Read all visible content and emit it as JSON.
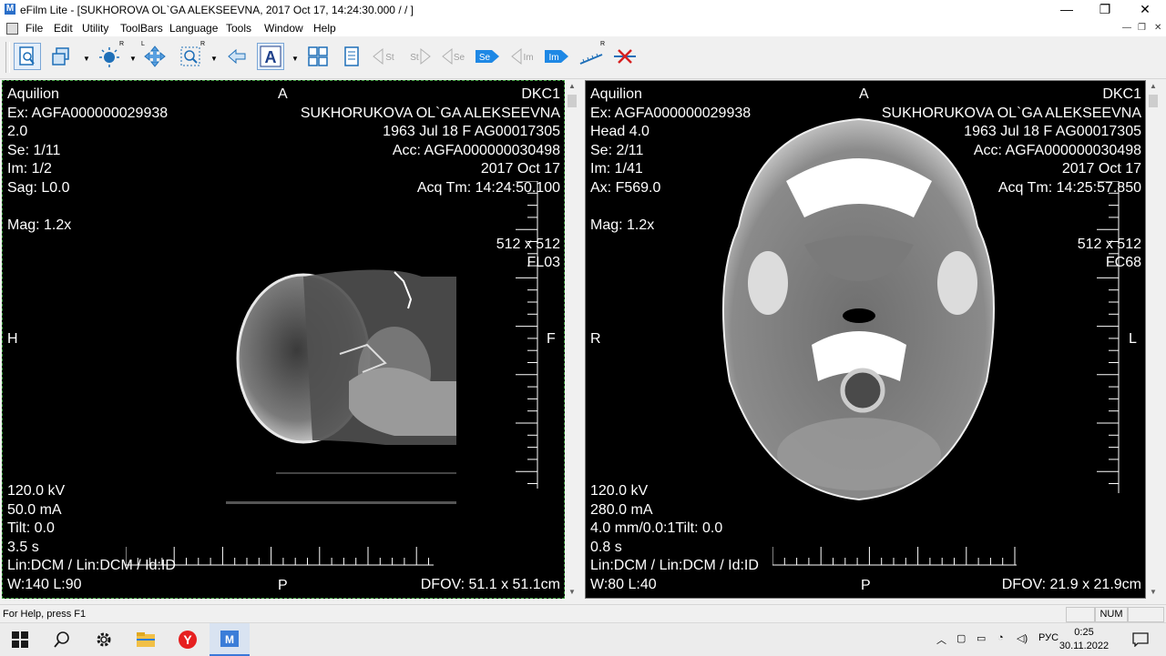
{
  "window": {
    "title": "eFilm Lite - [SUKHOROVA OL`GA ALEKSEEVNA, 2017 Oct 17, 14:24:30.000 /  /  ]",
    "app_icon": "M",
    "minimize": "—",
    "restore": "❐",
    "close": "✕"
  },
  "menu": [
    "File",
    "Edit",
    "Utility",
    "ToolBars",
    "Language",
    "Tools",
    "Window",
    "Help"
  ],
  "mdi": {
    "minimize": "—",
    "restore": "❐",
    "close": "✕"
  },
  "toolbar": {
    "buttons": [
      "page-icon",
      "series-layout-icon",
      "window-level-icon",
      "pan-icon",
      "zoom-icon",
      "previous-icon",
      "annotation-text-icon",
      "tile-layout-icon",
      "report-icon",
      "first-study-icon",
      "last-study-icon",
      "previous-series-icon",
      "next-series-icon",
      "previous-image-icon",
      "next-image-icon",
      "ruler-icon",
      "delete-icon"
    ],
    "labels": {
      "st1": "St",
      "st2": "St",
      "se1": "Se",
      "se2": "Se",
      "im1": "Im",
      "im2": "Im"
    },
    "superscripts": {
      "r": "R",
      "l": "L"
    }
  },
  "viewports": [
    {
      "top_left": [
        "Aquilion",
        "Ex: AGFA000000029938",
        " 2.0",
        "Se: 1/11",
        "Im: 1/2",
        "Sag: L0.0",
        "",
        "Mag: 1.2x"
      ],
      "top_right": [
        "DKC1",
        "SUKHORUKOVA OL`GA ALEKSEEVNA",
        "1963 Jul 18  F  AG00017305",
        "Acc: AGFA000000030498",
        "2017 Oct 17",
        "Acq Tm: 14:24:50.100",
        "",
        "",
        "512 x 512",
        "FL03"
      ],
      "top_center": "A",
      "left_mid": "H",
      "right_mid": "F",
      "bottom_center": "P",
      "bottom_left": [
        "120.0 kV",
        "50.0 mA",
        "Tilt: 0.0",
        "3.5 s",
        "Lin:DCM / Lin:DCM / Id:ID",
        "W:140  L:90"
      ],
      "bottom_right": "DFOV: 51.1 x 51.1cm"
    },
    {
      "top_left": [
        "Aquilion",
        "Ex: AGFA000000029938",
        " Head 4.0",
        "Se: 2/11",
        "Im: 1/41",
        "Ax: F569.0",
        "",
        "Mag: 1.2x"
      ],
      "top_right": [
        "DKC1",
        "SUKHORUKOVA OL`GA ALEKSEEVNA",
        "1963 Jul 18  F  AG00017305",
        "Acc: AGFA000000030498",
        "2017 Oct 17",
        "Acq Tm: 14:25:57.850",
        "",
        "",
        "512 x 512",
        "FC68"
      ],
      "top_center": "A",
      "left_mid": "R",
      "right_mid": "L",
      "bottom_center": "P",
      "bottom_left": [
        "120.0 kV",
        "280.0 mA",
        "4.0 mm/0.0:1Tilt: 0.0",
        "0.8 s",
        "Lin:DCM / Lin:DCM / Id:ID",
        "W:80  L:40"
      ],
      "bottom_right": "DFOV: 21.9 x 21.9cm"
    }
  ],
  "status": {
    "help": "For Help, press F1",
    "num": "NUM"
  },
  "taskbar": {
    "items": [
      "windows-start-icon",
      "search-icon",
      "settings-icon",
      "file-explorer-icon",
      "yandex-browser-icon",
      "efilm-icon"
    ],
    "tray": {
      "lang": "РУС",
      "time": "0:25",
      "date": "30.11.2022"
    }
  },
  "colors": {
    "accent": "#1e88e5",
    "viewport_bg": "#000000",
    "overlay_text": "#ffffff"
  }
}
